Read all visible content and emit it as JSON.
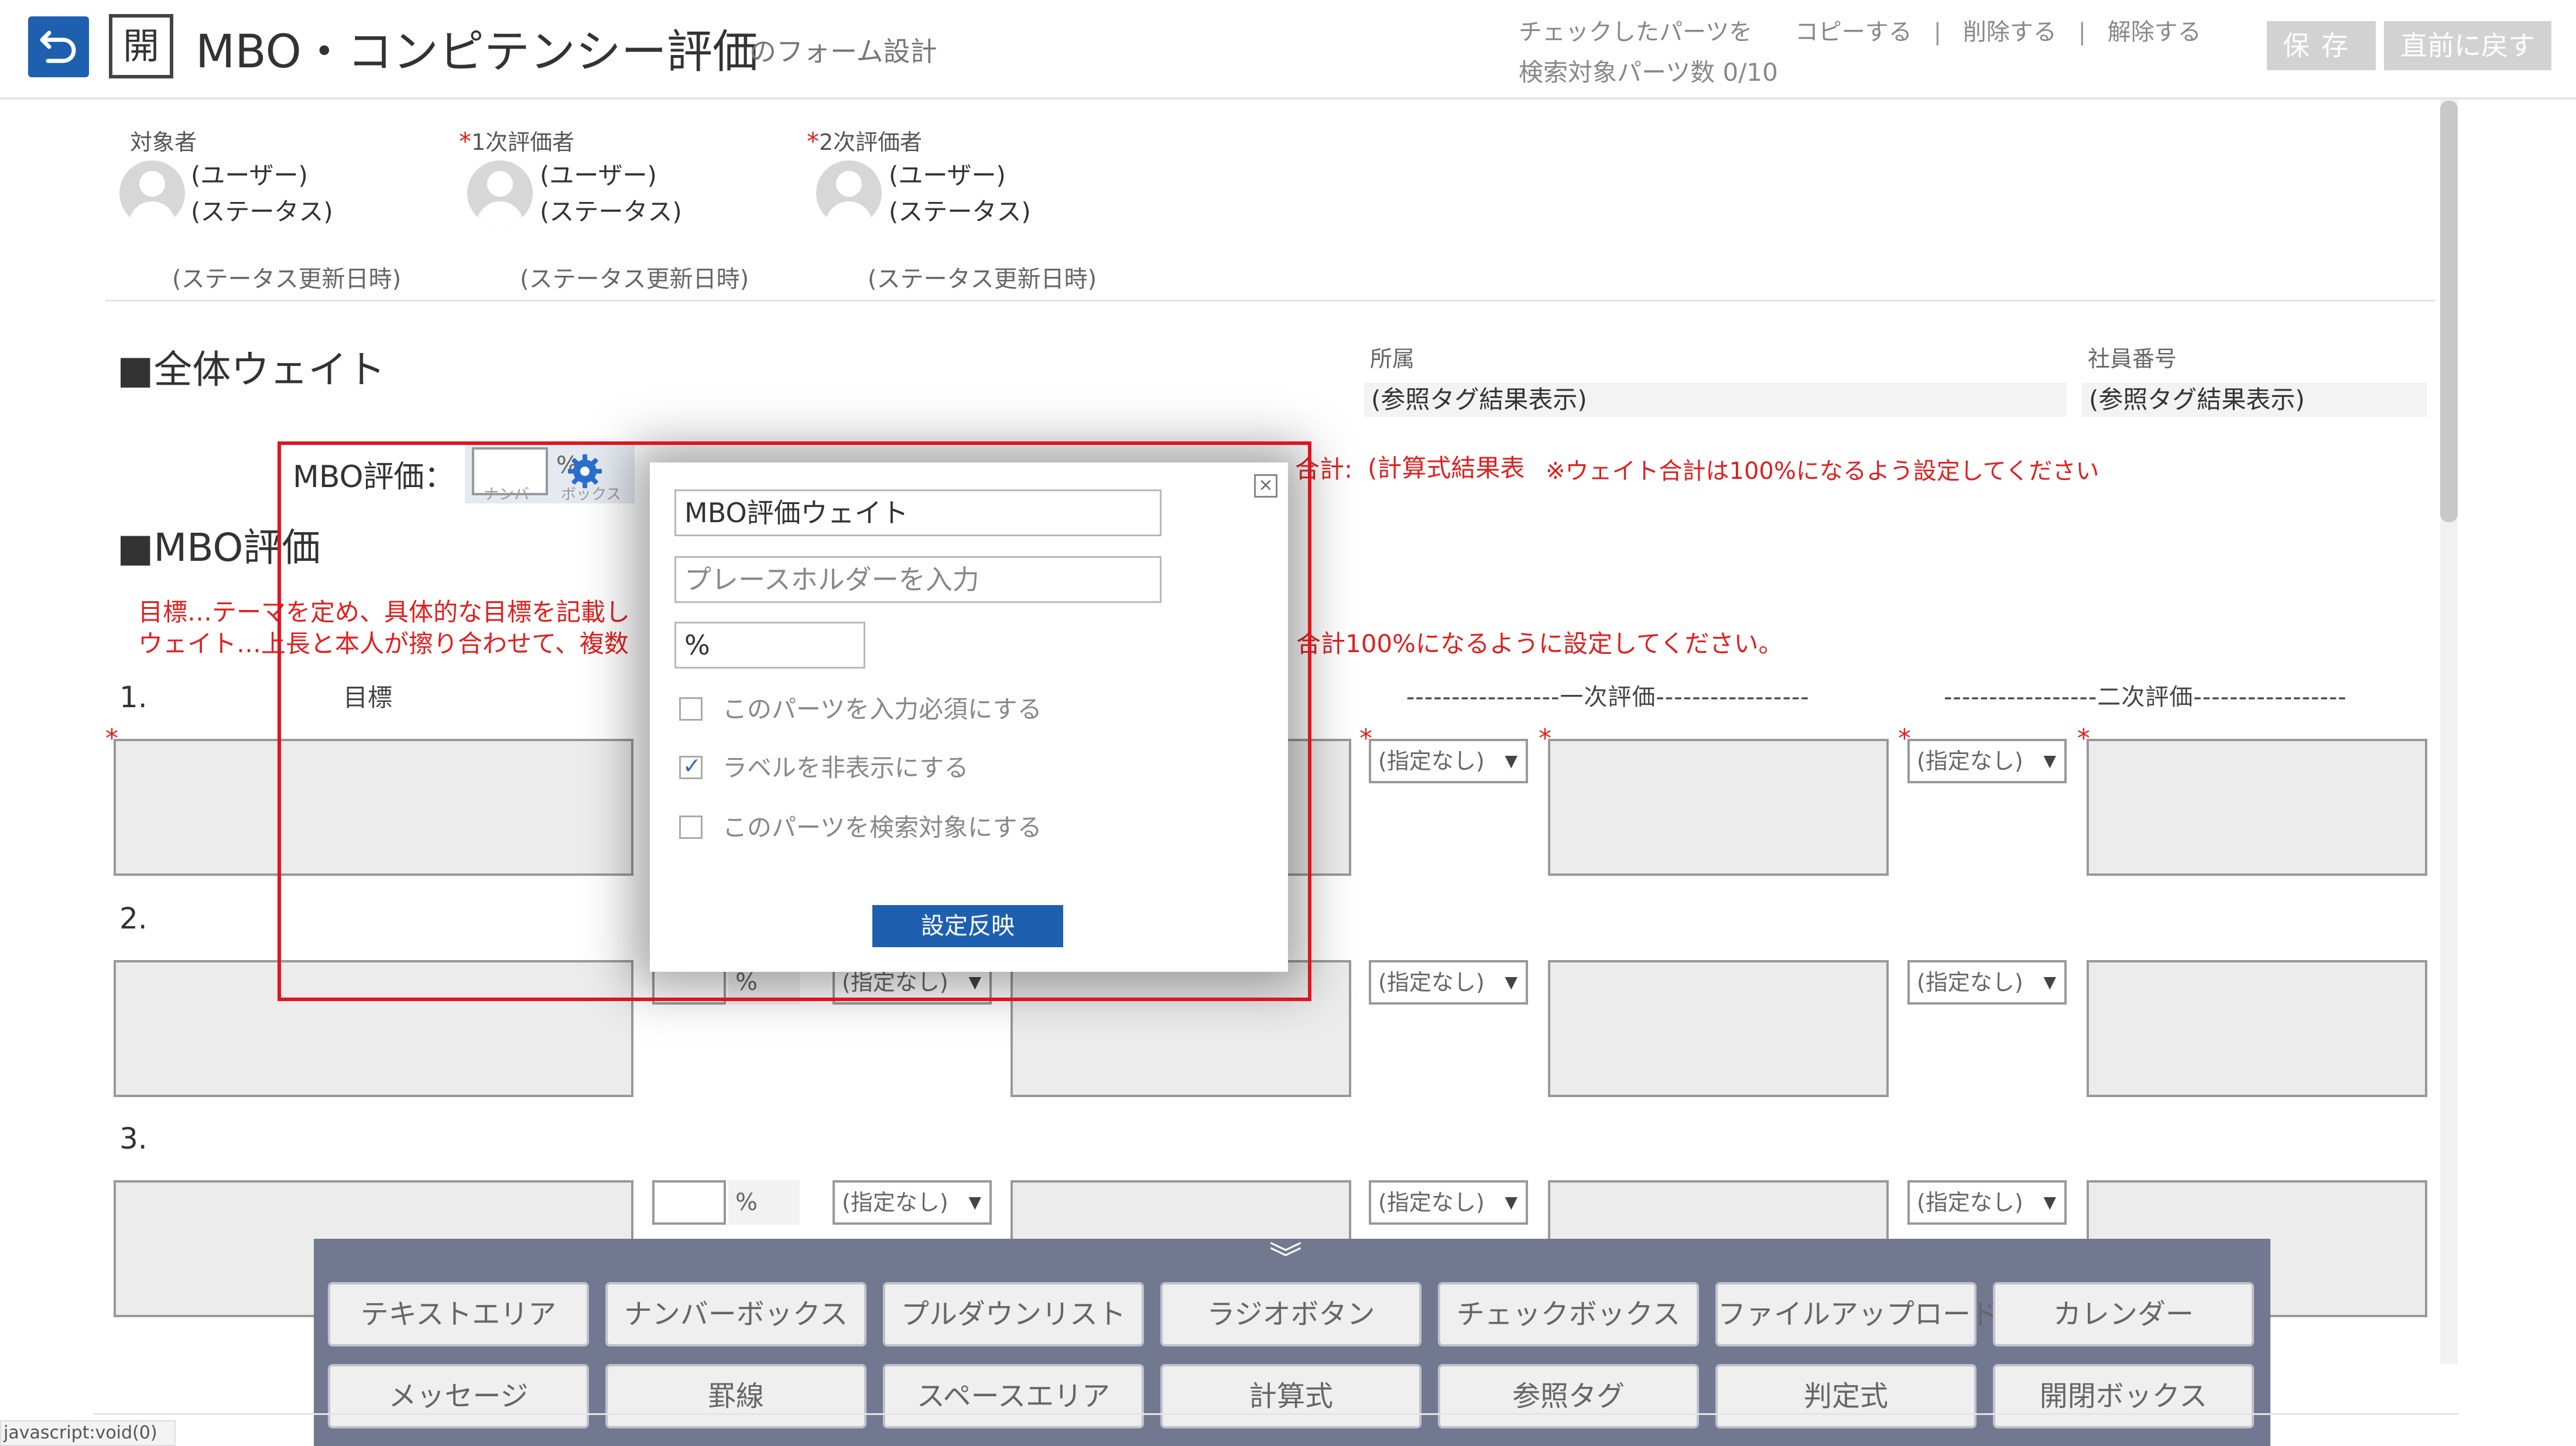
{
  "header": {
    "open_label": "開",
    "title": "MBO・コンピテンシー評価",
    "subtitle": "のフォーム設計",
    "checked_parts_label": "チェックしたパーツを",
    "copy_label": "コピーする",
    "delete_label": "削除する",
    "unset_label": "解除する",
    "separator": "|",
    "search_count": "検索対象パーツ数 0/10",
    "save_label": "保存",
    "revert_label": "直前に戻す"
  },
  "evaluators": [
    {
      "label": "対象者",
      "required": false,
      "user": "(ユーザー)",
      "status": "(ステータス)",
      "updated": "(ステータス更新日時)"
    },
    {
      "label": "1次評価者",
      "required": true,
      "user": "(ユーザー)",
      "status": "(ステータス)",
      "updated": "(ステータス更新日時)"
    },
    {
      "label": "2次評価者",
      "required": true,
      "user": "(ユーザー)",
      "status": "(ステータス)",
      "updated": "(ステータス更新日時)"
    }
  ],
  "required_mark": "*",
  "overall": {
    "title": "■全体ウェイト",
    "affiliation_label": "所属",
    "affiliation_value": "(参照タグ結果表示)",
    "employee_no_label": "社員番号",
    "employee_no_value": "(参照タグ結果表示)",
    "mbo_weight_label": "MBO評価：",
    "pct": "%",
    "ghost_number": "ナンバ",
    "ghost_box": "ボックス",
    "total_label": "合計:",
    "calc_result": "(計算式結果表",
    "weight_note": "※ウェイト合計は100%になるよう設定してください"
  },
  "mbo": {
    "title": "■MBO評価",
    "desc1": "目標…テーマを定め、具体的な目標を記載し",
    "desc2": "ウェイト…上長と本人が擦り合わせて、複数",
    "desc2_tail": "合計100%になるように設定してください。",
    "target_head": "目標",
    "first_eval_head": "-----------------一次評価-----------------",
    "second_eval_head": "-----------------二次評価-----------------",
    "rows": [
      "1.",
      "2.",
      "3."
    ],
    "select_default": "(指定なし)",
    "pct": "%"
  },
  "popup": {
    "close": "×",
    "label_value": "MBO評価ウェイト",
    "placeholder_value": "プレースホルダーを入力",
    "unit_value": "%",
    "opt_required": "このパーツを入力必須にする",
    "opt_hide_label": "ラベルを非表示にする",
    "opt_hide_label_checked": true,
    "opt_search": "このパーツを検索対象にする",
    "apply_label": "設定反映"
  },
  "palette": {
    "toggle": "︾",
    "row1": [
      "テキストエリア",
      "ナンバーボックス",
      "プルダウンリスト",
      "ラジオボタン",
      "チェックボックス",
      "ファイルアップロード",
      "カレンダー"
    ],
    "row2": [
      "メッセージ",
      "罫線",
      "スペースエリア",
      "計算式",
      "参照タグ",
      "判定式",
      "開閉ボックス"
    ]
  },
  "status_url": "javascript:void(0)",
  "colors": {
    "accent": "#1f5fb0",
    "alert": "#e0141e",
    "palette_bg": "#737891"
  }
}
